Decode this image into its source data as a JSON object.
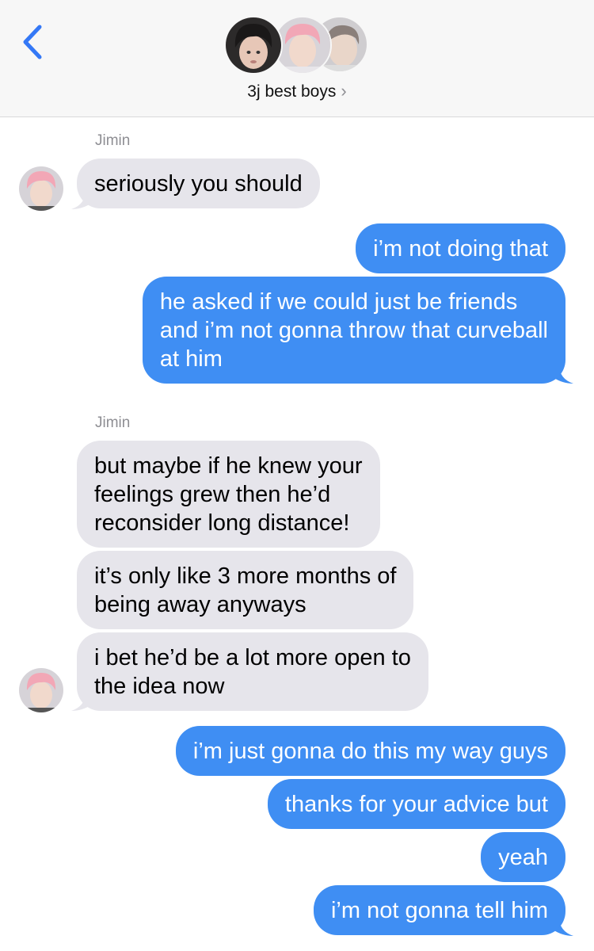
{
  "header": {
    "group_name": "3j best boys",
    "chevron": "›",
    "back_icon": "chevron-left-icon",
    "accent_color": "#3478f6"
  },
  "conversation": {
    "sender_1": "Jimin",
    "msg_1": "seriously you should",
    "msg_2": "i’m not doing that",
    "msg_3_line_1": "he asked if we could just be friends",
    "msg_3_line_2": "and i’m not gonna throw that curveball",
    "msg_3_line_3": "at him",
    "sender_2": "Jimin",
    "msg_4_line_1": "but maybe if he knew your",
    "msg_4_line_2": "feelings grew then he’d",
    "msg_4_line_3": "reconsider long distance!",
    "msg_5_line_1": "it’s only like 3 more months of",
    "msg_5_line_2": "being away anyways",
    "msg_6_line_1": "i bet he’d be a lot more open to",
    "msg_6_line_2": "the idea now",
    "msg_7": "i’m just gonna do this my way guys",
    "msg_8": "thanks for your advice but",
    "msg_9": "yeah",
    "msg_10": "i’m not gonna tell him"
  },
  "colors": {
    "incoming_bubble": "#e6e5eb",
    "outgoing_bubble": "#3f8ef3"
  }
}
